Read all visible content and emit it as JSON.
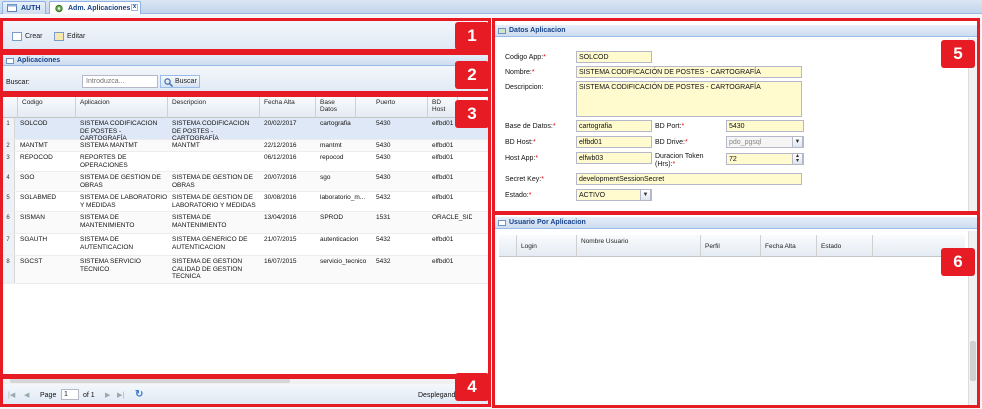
{
  "tabs": [
    {
      "label": "AUTH"
    },
    {
      "label": "Adm. Aplicaciones",
      "close": "x"
    }
  ],
  "toolbar": {
    "create_label": "Crear",
    "edit_label": "Editar"
  },
  "apps_panel": {
    "title": "Aplicaciones",
    "search_label": "Buscar:",
    "search_placeholder": "Introduzca...",
    "search_button": "Buscar"
  },
  "grid": {
    "columns": [
      "Codigo",
      "Aplicacion",
      "Descripcion",
      "Fecha Alta",
      "Base Datos",
      "Puerto",
      "BD Host"
    ],
    "rows": [
      {
        "n": "1",
        "codigo": "SOLCOD",
        "aplicacion": "SISTEMA CODIFICACIÓN DE POSTES - CARTOGRAFÍA",
        "descripcion": "SISTEMA CODIFICACIÓN DE POSTES - CARTOGRAFÍA",
        "fecha": "20/02/2017",
        "bd": "cartografia",
        "puerto": "5430",
        "host": "elfbd01"
      },
      {
        "n": "2",
        "codigo": "MANTMT",
        "aplicacion": "SISTEMA MANTMT",
        "descripcion": "MANTMT",
        "fecha": "22/12/2016",
        "bd": "mantmt",
        "puerto": "5430",
        "host": "elfbd01"
      },
      {
        "n": "3",
        "codigo": "REPOCOD",
        "aplicacion": "REPORTES DE OPERACIONES",
        "descripcion": "",
        "fecha": "06/12/2016",
        "bd": "repocod",
        "puerto": "5430",
        "host": "elfbd01"
      },
      {
        "n": "4",
        "codigo": "SGO",
        "aplicacion": "SISTEMA DE GESTION DE OBRAS",
        "descripcion": "SISTEMA DE GESTION DE OBRAS",
        "fecha": "20/07/2016",
        "bd": "sgo",
        "puerto": "5430",
        "host": "elfbd01"
      },
      {
        "n": "5",
        "codigo": "SGLABMED",
        "aplicacion": "SISTEMA DE LABORATORIO Y MEDIDAS",
        "descripcion": "SISTEMA DE GESTION DE LABORATORIO Y MEDIDAS",
        "fecha": "30/08/2016",
        "bd": "laboratorio_m...",
        "puerto": "5432",
        "host": "elfbd01"
      },
      {
        "n": "6",
        "codigo": "SISMAN",
        "aplicacion": "SISTEMA DE MANTENIMIENTO",
        "descripcion": "SISTEMA DE MANTENIMIENTO",
        "fecha": "13/04/2016",
        "bd": "SPROD",
        "puerto": "1531",
        "host": "ORACLE_SID"
      },
      {
        "n": "7",
        "codigo": "SGAUTH",
        "aplicacion": "SISTEMA DE AUTENTICACION",
        "descripcion": "SISTEMA GENERICO DE AUTENTICACION",
        "fecha": "21/07/2015",
        "bd": "autenticacion",
        "puerto": "5432",
        "host": "elfbd01"
      },
      {
        "n": "8",
        "codigo": "SGCST",
        "aplicacion": "SISTEMA SERVICIO TECNICO",
        "descripcion": "SISTEMA DE GESTION CALIDAD DE GESTION TECNICA",
        "fecha": "16/07/2015",
        "bd": "servicio_tecnico",
        "puerto": "5432",
        "host": "elfbd01"
      }
    ]
  },
  "pager": {
    "page_label": "Page",
    "page_value": "1",
    "of_label": "of 1",
    "status": "Desplegando"
  },
  "details": {
    "title": "Datos Aplicacion",
    "codigo_label": "Codigo App:",
    "codigo": "SOLCOD",
    "nombre_label": "Nombre:",
    "nombre": "SISTEMA CODIFICACIÓN DE POSTES - CARTOGRAFÍA",
    "descripcion_label": "Descripcion:",
    "descripcion": "SISTEMA CODIFICACIÓN DE POSTES - CARTOGRAFÍA",
    "bd_label": "Base de Datos:",
    "bd": "cartografia",
    "port_label": "BD Port:",
    "port": "5430",
    "host_label": "BD Host:",
    "host": "elfbd01",
    "drive_label": "BD Drive:",
    "drive": "pdo_pgsql",
    "hostapp_label": "Host App:",
    "hostapp": "elfwb03",
    "token_label1": "Duracion Token",
    "token_label2": "(Hrs):",
    "token": "72",
    "secret_label": "Secret Key:",
    "secret": "developmentSessionSecret",
    "estado_label": "Estado:",
    "estado": "ACTIVO"
  },
  "users_panel": {
    "title": "Usuario Por Aplicacion",
    "columns": [
      "Login",
      "Nombre Usuario",
      "Perfil",
      "Fecha Alta",
      "Estado"
    ]
  },
  "badges": [
    "1",
    "2",
    "3",
    "4",
    "5",
    "6"
  ],
  "colors": {
    "annotation": "#e61b23",
    "header_text": "#15428b",
    "required_field": "#fffbcf",
    "selected_row": "#dfe8f6"
  }
}
